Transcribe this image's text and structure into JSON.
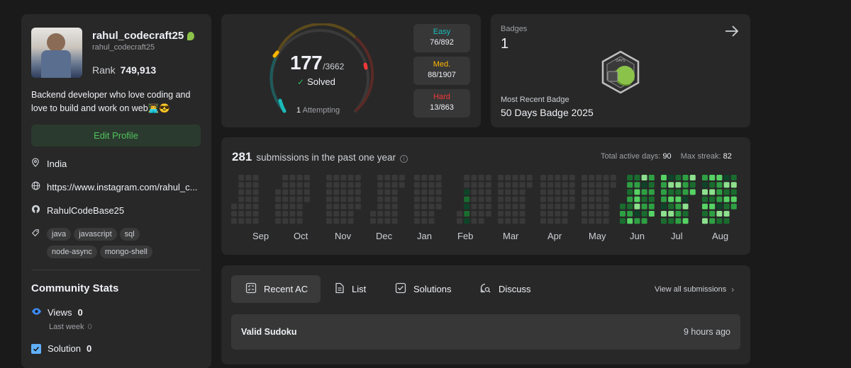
{
  "profile": {
    "username": "rahul_codecraft25",
    "handle": "rahul_codecraft25",
    "rank_label": "Rank",
    "rank_value": "749,913",
    "bio": "Backend developer who love coding and love to build and work on web👨‍💻😎",
    "edit_label": "Edit Profile",
    "location": "India",
    "website": "https://www.instagram.com/rahul_c...",
    "github": "RahulCodeBase25",
    "tags": [
      "java",
      "javascript",
      "sql",
      "node-async",
      "mongo-shell"
    ]
  },
  "community": {
    "title": "Community Stats",
    "views_label": "Views",
    "views_value": "0",
    "last_week_label": "Last week",
    "last_week_value": "0",
    "solution_label": "Solution",
    "solution_value": "0"
  },
  "progress": {
    "solved": "177",
    "total": "/3662",
    "solved_label": "Solved",
    "attempting_count": "1",
    "attempting_label": "Attempting",
    "easy_label": "Easy",
    "easy_value": "76/892",
    "med_label": "Med.",
    "med_value": "88/1907",
    "hard_label": "Hard",
    "hard_value": "13/863",
    "easy_color": "#1cbaba",
    "med_color": "#ffb700",
    "hard_color": "#f63737"
  },
  "badges": {
    "title": "Badges",
    "count": "1",
    "recent_label": "Most Recent Badge",
    "recent_name": "50 Days Badge 2025",
    "badge_text": "DAYS"
  },
  "submissions": {
    "count": "281",
    "label": "submissions in the past one year",
    "active_label": "Total active days:",
    "active_value": "90",
    "streak_label": "Max streak:",
    "streak_value": "82",
    "months": [
      "Sep",
      "Oct",
      "Nov",
      "Dec",
      "Jan",
      "Feb",
      "Mar",
      "Apr",
      "May",
      "Jun",
      "Jul",
      "Aug"
    ]
  },
  "tabs": {
    "recent": "Recent AC",
    "list": "List",
    "solutions": "Solutions",
    "discuss": "Discuss",
    "view_all": "View all submissions"
  },
  "recent_items": [
    {
      "title": "Valid Sudoku",
      "time": "9 hours ago"
    }
  ]
}
